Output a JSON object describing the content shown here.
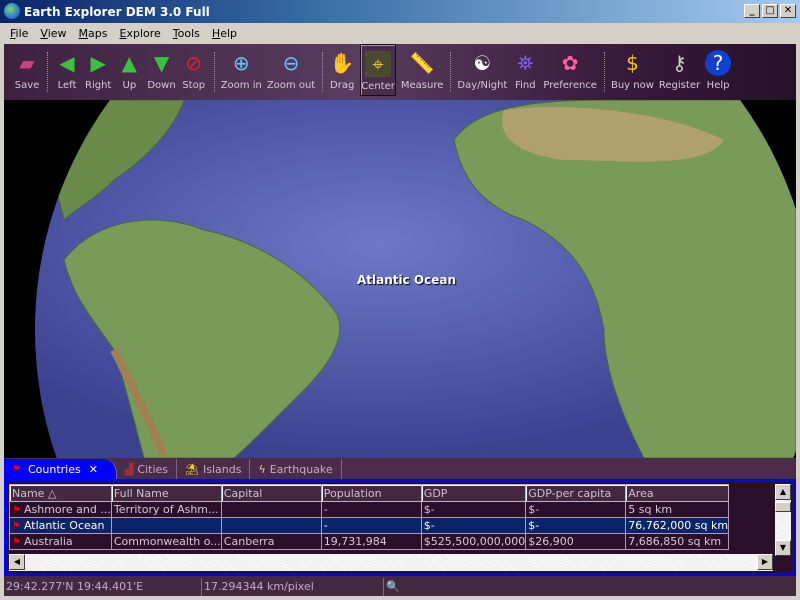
{
  "window": {
    "title": "Earth Explorer DEM 3.0 Full",
    "min": "_",
    "max": "□",
    "close": "✕"
  },
  "menu": [
    {
      "label": "File",
      "key": "F",
      "rest": "ile"
    },
    {
      "label": "View",
      "key": "V",
      "rest": "iew"
    },
    {
      "label": "Maps",
      "key": "M",
      "rest": "aps"
    },
    {
      "label": "Explore",
      "key": "E",
      "rest": "xplore"
    },
    {
      "label": "Tools",
      "key": "T",
      "rest": "ools"
    },
    {
      "label": "Help",
      "key": "H",
      "rest": "elp"
    }
  ],
  "toolbar": {
    "save": "Save",
    "left": "Left",
    "right": "Right",
    "up": "Up",
    "down": "Down",
    "stop": "Stop",
    "zoom_in": "Zoom in",
    "zoom_out": "Zoom out",
    "drag": "Drag",
    "center": "Center",
    "measure": "Measure",
    "day_night": "Day/Night",
    "find": "Find",
    "preference": "Preference",
    "buy_now": "Buy now",
    "register": "Register",
    "help": "Help"
  },
  "map": {
    "label": "Atlantic Ocean"
  },
  "tabs": {
    "countries": "Countries",
    "cities": "Cities",
    "islands": "Islands",
    "earthquake": "Earthquake"
  },
  "table": {
    "columns": [
      "Name △",
      "Full Name",
      "Capital",
      "Population",
      "GDP",
      "GDP-per capita",
      "Area"
    ],
    "rows": [
      [
        "Ashmore and ...",
        "Territory of Ashm...",
        "",
        "-",
        "$-",
        "$-",
        "5 sq km"
      ],
      [
        "Atlantic Ocean",
        "",
        "",
        "-",
        "$-",
        "$-",
        "76,762,000 sq km"
      ],
      [
        "Australia",
        "Commonwealth o...",
        "Canberra",
        "19,731,984",
        "$525,500,000,000",
        "$26,900",
        "7,686,850 sq km"
      ]
    ],
    "selected_row": 1
  },
  "status": {
    "coords": "29:42.277'N  19:44.401'E",
    "scale": "17.294344 km/pixel"
  }
}
